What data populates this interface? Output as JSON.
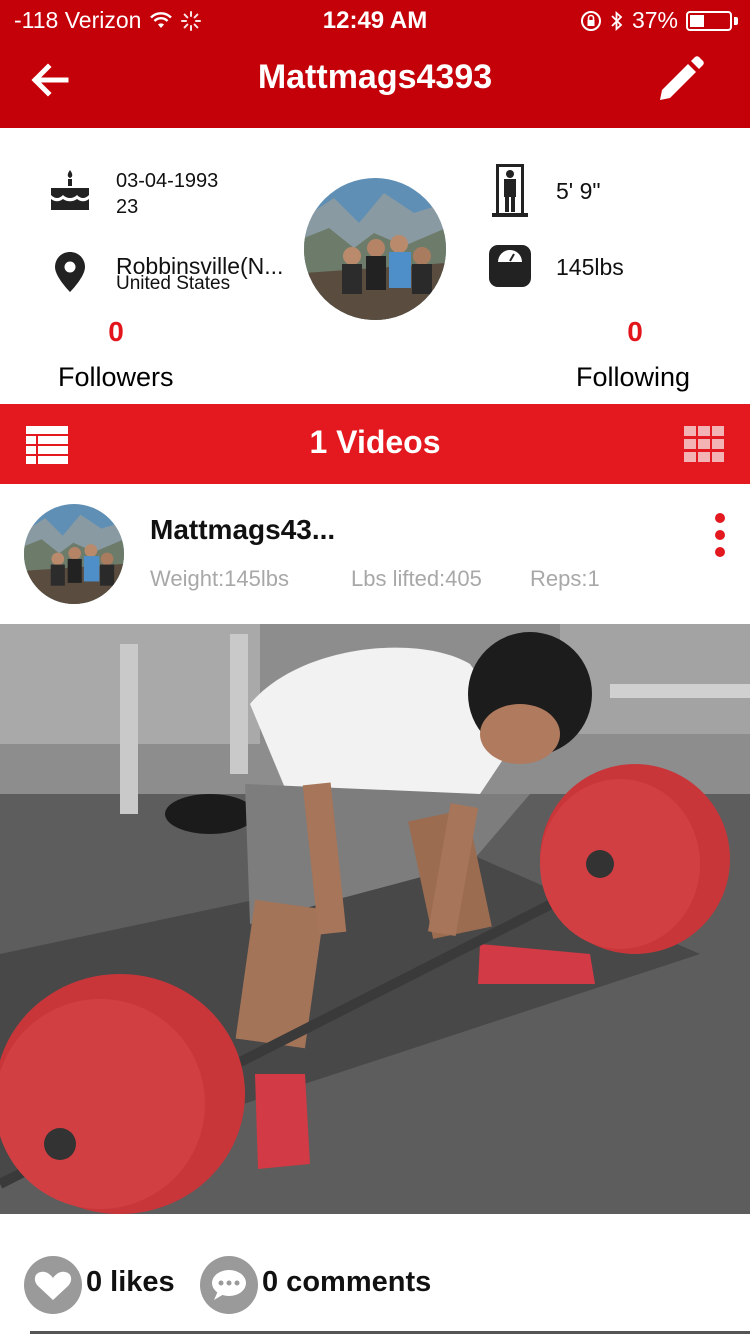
{
  "status_bar": {
    "carrier": "-118 Verizon",
    "time": "12:49 AM",
    "battery": "37%",
    "battery_level": 0.37
  },
  "nav": {
    "title": "Mattmags4393",
    "back_icon": "arrow-left-icon",
    "edit_icon": "pencil-icon"
  },
  "profile": {
    "birthdate": "03-04-1993",
    "age": "23",
    "city": "Robbinsville(N...",
    "country": "United States",
    "height": "5' 9\"",
    "weight": "145lbs",
    "followers_count": "0",
    "followers_label": "Followers",
    "following_count": "0",
    "following_label": "Following"
  },
  "videos_bar": {
    "title": "1 Videos"
  },
  "post": {
    "username": "Mattmags43...",
    "weight": "Weight:145lbs",
    "lbs_lifted": "Lbs lifted:405",
    "reps": "Reps:1",
    "likes": "0 likes",
    "comments": "0 comments"
  },
  "colors": {
    "header": "#c40009",
    "accent": "#e3191f",
    "count": "#e3151c"
  }
}
